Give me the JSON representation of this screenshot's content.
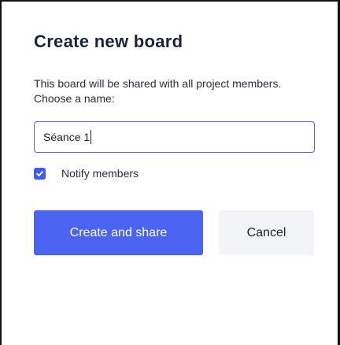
{
  "dialog": {
    "title": "Create new board",
    "description": "This board will be shared with all project members. Choose a name:",
    "name_input_value": "Séance 1",
    "notify": {
      "label": "Notify members",
      "checked": true
    },
    "create_button_label": "Create and share",
    "cancel_button_label": "Cancel"
  },
  "colors": {
    "accent": "#4a63f0",
    "title": "#1c2340",
    "text": "#2b2f3a",
    "secondary_button_bg": "#f3f4f6"
  },
  "icons": {
    "notify_checkbox": "checkmark-icon"
  }
}
